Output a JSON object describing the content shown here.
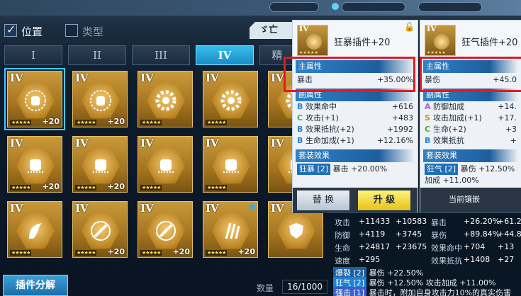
{
  "filters": {
    "position_label": "位置",
    "type_label": "类型",
    "sort_label": "ゞ亡"
  },
  "tabs": [
    "I",
    "II",
    "III",
    "IV",
    "精"
  ],
  "grid": [
    {
      "tier": "IV",
      "level": "+20",
      "stars": "★★★★★",
      "icon": "sunburst-fist-icon",
      "selected": true
    },
    {
      "tier": "IV",
      "level": "+20",
      "stars": "★★★★★",
      "icon": "sunburst-fist-icon"
    },
    {
      "tier": "IV",
      "level": "",
      "stars": "★★★★★",
      "icon": "gear-icon"
    },
    {
      "tier": "IV",
      "level": "",
      "stars": "★★★★★",
      "icon": "gear-icon"
    },
    {
      "tier": "IV",
      "level": "",
      "stars": "",
      "icon": "gear-icon"
    },
    {
      "tier": "IV",
      "level": "+20",
      "stars": "★★★★★",
      "icon": "fist-icon"
    },
    {
      "tier": "IV",
      "level": "+20",
      "stars": "★★★★★",
      "icon": "fist-icon"
    },
    {
      "tier": "IV",
      "level": "",
      "stars": "★★★★★",
      "icon": "fist-icon"
    },
    {
      "tier": "IV",
      "level": "",
      "stars": "★★★★★",
      "icon": "fist-icon"
    },
    {
      "tier": "IV",
      "level": "",
      "stars": "",
      "icon": "fist-icon"
    },
    {
      "tier": "IV",
      "level": "",
      "stars": "★★★★★",
      "icon": "wing-icon"
    },
    {
      "tier": "IV",
      "level": "+20",
      "stars": "★★★★★",
      "icon": "sword-icon"
    },
    {
      "tier": "IV",
      "level": "+20",
      "stars": "★★★★★",
      "icon": "sword-icon"
    },
    {
      "tier": "IV",
      "level": "+20",
      "stars": "★★★★★",
      "icon": "claw-icon",
      "pinned": true
    },
    {
      "tier": "IV",
      "level": "",
      "stars": "",
      "icon": "shield-gear-icon"
    }
  ],
  "bottom": {
    "decompose_label": "插件分解",
    "qty_label": "数量",
    "qty_value": "16/1000"
  },
  "card1": {
    "tier": "IV",
    "stars": "★★★★★",
    "name": "狂暴插件+20",
    "main_title": "主属性",
    "main_stat": "暴击",
    "main_value": "+35.00%",
    "sub_title": "副属性",
    "subs": [
      {
        "grade": "B",
        "name": "效果命中",
        "value": "+616"
      },
      {
        "grade": "C",
        "name": "攻击(+1)",
        "value": "+483"
      },
      {
        "grade": "B",
        "name": "效果抵抗(+2)",
        "value": "+1992"
      },
      {
        "grade": "B",
        "name": "生命加成(+1)",
        "value": "+12.16%"
      }
    ],
    "set_title": "套装效果",
    "set_tag": "狂暴",
    "set_count": "[2]",
    "set_text": "暴击 +20.00%",
    "btn_replace": "替 换",
    "btn_upgrade": "升 级"
  },
  "card2": {
    "tier": "IV",
    "stars": "★★★★★",
    "name": "狂气插件+20",
    "main_title": "主属性",
    "main_stat": "暴伤",
    "main_value": "+45.0",
    "sub_title": "副属性",
    "subs": [
      {
        "grade": "A",
        "name": "防御加成",
        "value": "+14."
      },
      {
        "grade": "S",
        "name": "攻击加成(+1)",
        "value": "+17."
      },
      {
        "grade": "C",
        "name": "生命(+2)",
        "value": "+3"
      },
      {
        "grade": "B",
        "name": "效果抵抗",
        "value": "+"
      }
    ],
    "set_title": "套装效果",
    "set_tag": "狂气",
    "set_count": "[2]",
    "set_text": "暴伤 +12.50%",
    "set_text2": "加成 +11.00%",
    "btn_pre": "当前镶嵌"
  },
  "stats": {
    "rows": [
      {
        "l1": "攻击",
        "v1": "+11433",
        "d1": "+10583",
        "c1": "red",
        "l2": "暴击",
        "v2": "+26.20%",
        "d2": "+61.20",
        "c2": "green"
      },
      {
        "l1": "防御",
        "v1": "+4119",
        "d1": "+3745",
        "c1": "red",
        "l2": "暴伤",
        "v2": "+89.84%",
        "d2": "+44.8",
        "c2": "red"
      },
      {
        "l1": "生命",
        "v1": "+24817",
        "d1": "+23675",
        "c1": "red",
        "l2": "效果命中",
        "v2": "+704",
        "d2": "+13",
        "c2": "green"
      },
      {
        "l1": "速度",
        "v1": "+295",
        "d1": "",
        "c1": "",
        "l2": "效果抵抗",
        "v2": "+1408",
        "d2": "+27",
        "c2": "green"
      }
    ],
    "sets": [
      {
        "tag": "爆裂",
        "count": "[2]",
        "text": "暴伤 +22.50%"
      },
      {
        "tag": "狂气",
        "count": "[2]",
        "text": "暴伤 +12.50%  攻击加成 +11.00%"
      },
      {
        "tag": "强击",
        "count": "[1]",
        "text": "暴击时，附加自身攻击力10%的真实伤害"
      }
    ]
  }
}
